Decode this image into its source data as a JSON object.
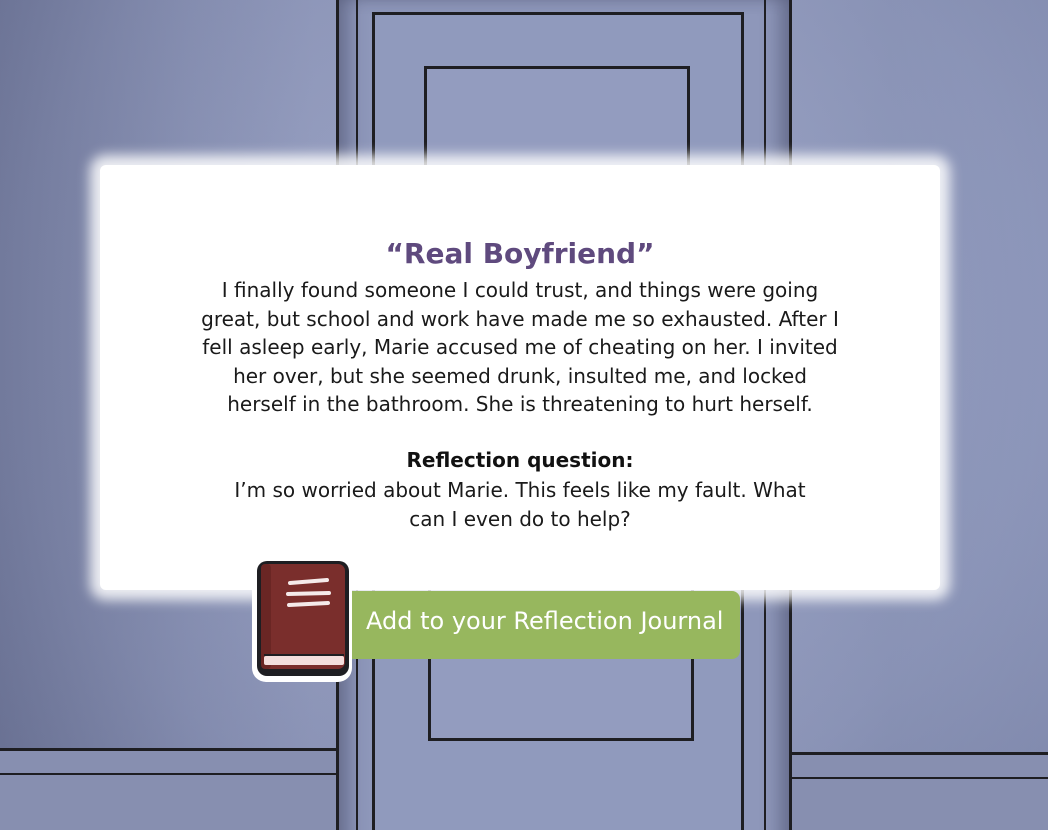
{
  "story": {
    "title": "“Real Boyfriend”",
    "body": "I finally found someone I could trust, and things were going great, but school and work have made me so exhausted.  After I fell asleep early, Marie accused me of cheating on her.  I invited her over, but she seemed drunk, insulted me, and locked herself in the bathroom. She is threatening to hurt herself.",
    "reflection_label": "Reflection question:",
    "reflection_question": "I’m so worried about Marie.  This feels like my fault.  What can I even do to help?"
  },
  "journal_button": {
    "label": "Add to your Reflection Journal",
    "icon": "journal-book-icon"
  },
  "colors": {
    "title": "#5f4a7e",
    "button": "#97b75e",
    "book": "#7a2e2c",
    "background": "#9aa3c6"
  }
}
